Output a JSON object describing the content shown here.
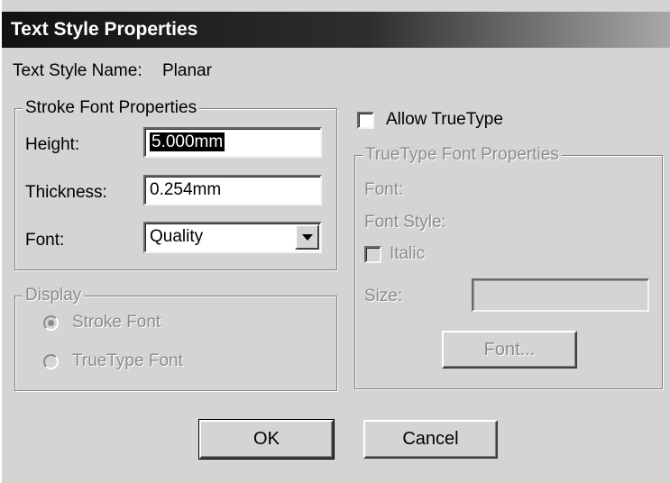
{
  "window": {
    "title": "Text Style Properties"
  },
  "style_name": {
    "label": "Text Style Name:",
    "value": "Planar"
  },
  "stroke_font": {
    "group_label": "Stroke Font Properties",
    "height_label": "Height:",
    "height_value": "5.000mm",
    "thickness_label": "Thickness:",
    "thickness_value": "0.254mm",
    "font_label": "Font:",
    "font_value": "Quality"
  },
  "display": {
    "group_label": "Display",
    "options": [
      {
        "label": "Stroke Font",
        "selected": true,
        "enabled": false
      },
      {
        "label": "TrueType Font",
        "selected": false,
        "enabled": false
      }
    ]
  },
  "allow_truetype": {
    "label": "Allow TrueType",
    "checked": false
  },
  "truetype_font": {
    "group_label": "TrueType Font Properties",
    "font_label": "Font:",
    "font_style_label": "Font Style:",
    "italic_label": "Italic",
    "italic_checked": false,
    "size_label": "Size:",
    "size_value": "",
    "font_button_label": "Font..."
  },
  "buttons": {
    "ok_label": "OK",
    "cancel_label": "Cancel"
  }
}
